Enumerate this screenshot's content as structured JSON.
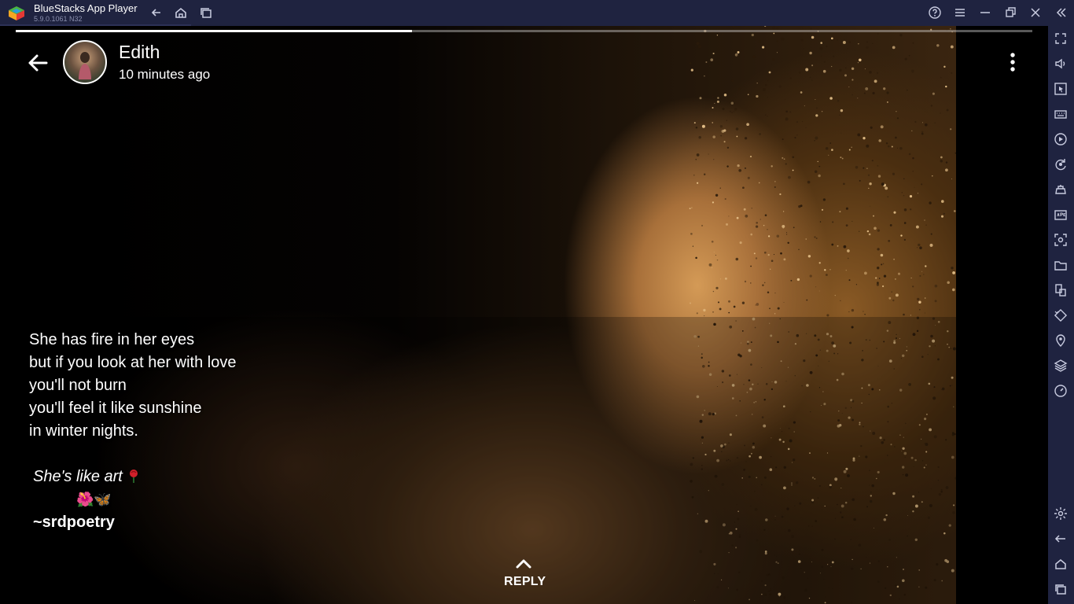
{
  "window": {
    "title": "BlueStacks App Player",
    "version": "5.9.0.1061 N32",
    "title_icons": [
      "back-icon",
      "home-icon",
      "multi-instance-icon"
    ],
    "window_controls": [
      "help-icon",
      "menu-icon",
      "minimize-icon",
      "restore-icon",
      "close-icon",
      "collapse-sidebar-icon"
    ]
  },
  "sidebar": {
    "items": [
      "fullscreen-icon",
      "volume-icon",
      "pointer-icon",
      "keyboard-icon",
      "macro-icon",
      "sync-icon",
      "game-controls-icon",
      "apk-icon",
      "screenshot-icon",
      "folder-icon",
      "multi-instance-icon",
      "rotate-icon",
      "location-icon",
      "layers-icon",
      "eco-mode-icon",
      "settings-icon",
      "android-back-icon",
      "android-home-icon",
      "android-recents-icon"
    ]
  },
  "story": {
    "progress": 0.39,
    "user_name": "Edith",
    "timestamp": "10 minutes ago",
    "caption_lines": [
      "She has fire in her eyes",
      "but if you look at her with love",
      "you'll not burn",
      "you'll feel it like sunshine",
      "in winter nights."
    ],
    "tagline": "She's like art",
    "emoji_row": "🌺🦋",
    "signature": "~srdpoetry",
    "reply_label": "REPLY"
  }
}
